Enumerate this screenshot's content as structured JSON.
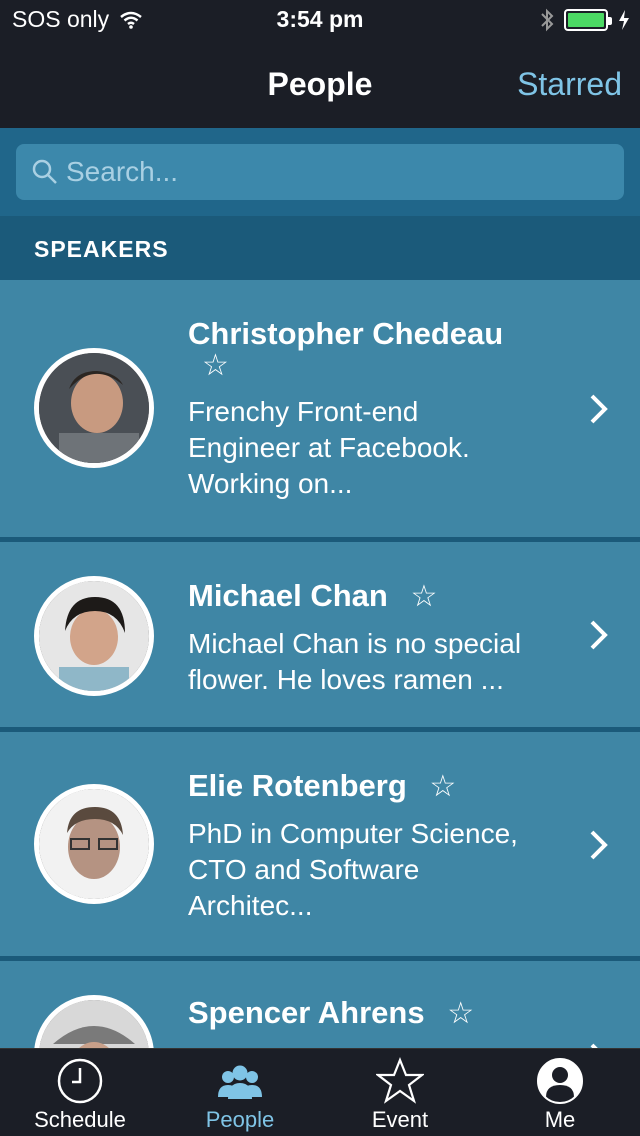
{
  "status_bar": {
    "carrier": "SOS only",
    "time": "3:54 pm"
  },
  "nav": {
    "title": "People",
    "right_action": "Starred"
  },
  "search": {
    "placeholder": "Search..."
  },
  "section": {
    "title": "SPEAKERS"
  },
  "speakers": [
    {
      "name": "Christopher Chedeau",
      "desc_lines": [
        "Frenchy Front-end",
        "Engineer at Facebook.",
        "Working on..."
      ]
    },
    {
      "name": "Michael Chan",
      "desc_lines": [
        "Michael Chan is no special",
        "flower. He loves ramen ..."
      ]
    },
    {
      "name": "Elie Rotenberg",
      "desc_lines": [
        "PhD in Computer Science,",
        "CTO and Software",
        "Architec..."
      ]
    },
    {
      "name": "Spencer Ahrens",
      "desc_lines": []
    }
  ],
  "tabs": [
    {
      "label": "Schedule",
      "icon": "clock-icon"
    },
    {
      "label": "People",
      "icon": "people-icon",
      "active": true
    },
    {
      "label": "Event",
      "icon": "star-icon"
    },
    {
      "label": "Me",
      "icon": "user-icon"
    }
  ],
  "colors": {
    "accent": "#7fc4e6",
    "row_bg": "#3f86a5",
    "section_bg": "#1b5a7a",
    "bar_bg": "#1b1e26"
  }
}
